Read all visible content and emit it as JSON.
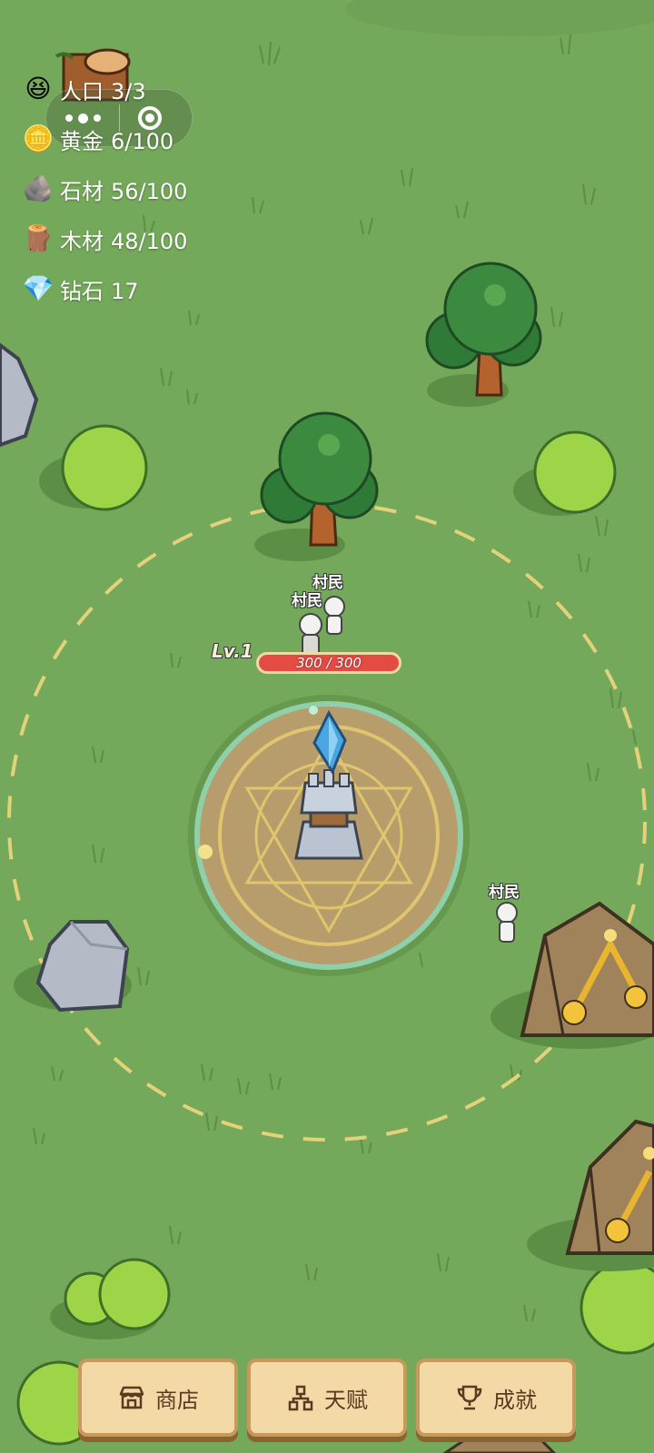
{
  "resources": [
    {
      "icon": "laughing-face-icon",
      "glyph": "😆",
      "name": "人口",
      "value": "3/3"
    },
    {
      "icon": "gold-coin-icon",
      "glyph": "🪙",
      "name": "黄金",
      "value": "6/100"
    },
    {
      "icon": "stone-icon",
      "glyph": "🪨",
      "name": "石材",
      "value": "56/100"
    },
    {
      "icon": "wood-log-icon",
      "glyph": "🪵",
      "name": "木材",
      "value": "48/100"
    },
    {
      "icon": "diamond-icon",
      "glyph": "💎",
      "name": "钻石",
      "value": "17"
    }
  ],
  "tower": {
    "level": "Lv.1",
    "hp": "300 / 300",
    "hp_fraction": 1.0
  },
  "villagers": [
    "村民",
    "村民",
    "村民"
  ],
  "nav": [
    {
      "label": "商店",
      "icon": "shop-icon"
    },
    {
      "label": "天赋",
      "icon": "talent-tree-icon"
    },
    {
      "label": "成就",
      "icon": "trophy-icon"
    }
  ],
  "colors": {
    "grass": "#74a85a",
    "dash_ring": "#e3d27a",
    "hp": "#e34c43",
    "button": "#f3d9a6",
    "button_border": "#c7995b",
    "button_text": "#5b3a22"
  }
}
